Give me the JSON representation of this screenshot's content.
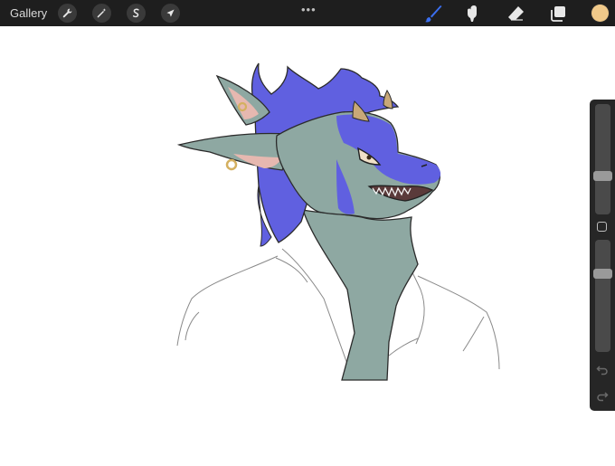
{
  "topbar": {
    "gallery_label": "Gallery",
    "actions_icon": "wrench-icon",
    "adjustments_icon": "magic-wand-icon",
    "selection_icon": "selection-s-icon",
    "transform_icon": "arrow-cursor-icon",
    "menu_dots": "•••",
    "brush_icon": "brush-icon",
    "smudge_icon": "smudge-icon",
    "eraser_icon": "eraser-icon",
    "layers_icon": "layers-icon",
    "color": "#f0c98a"
  },
  "sidebar": {
    "brush_size_level": 0.33,
    "opacity_level": 0.72,
    "undo_icon": "undo-icon",
    "redo_icon": "redo-icon"
  },
  "colors": {
    "toolbar": "#1e1e1e",
    "accent_brush": "#3b6ff0",
    "mane": "#6060e0",
    "skin": "#8ea8a2",
    "ear_inner": "#e6b8b0"
  }
}
